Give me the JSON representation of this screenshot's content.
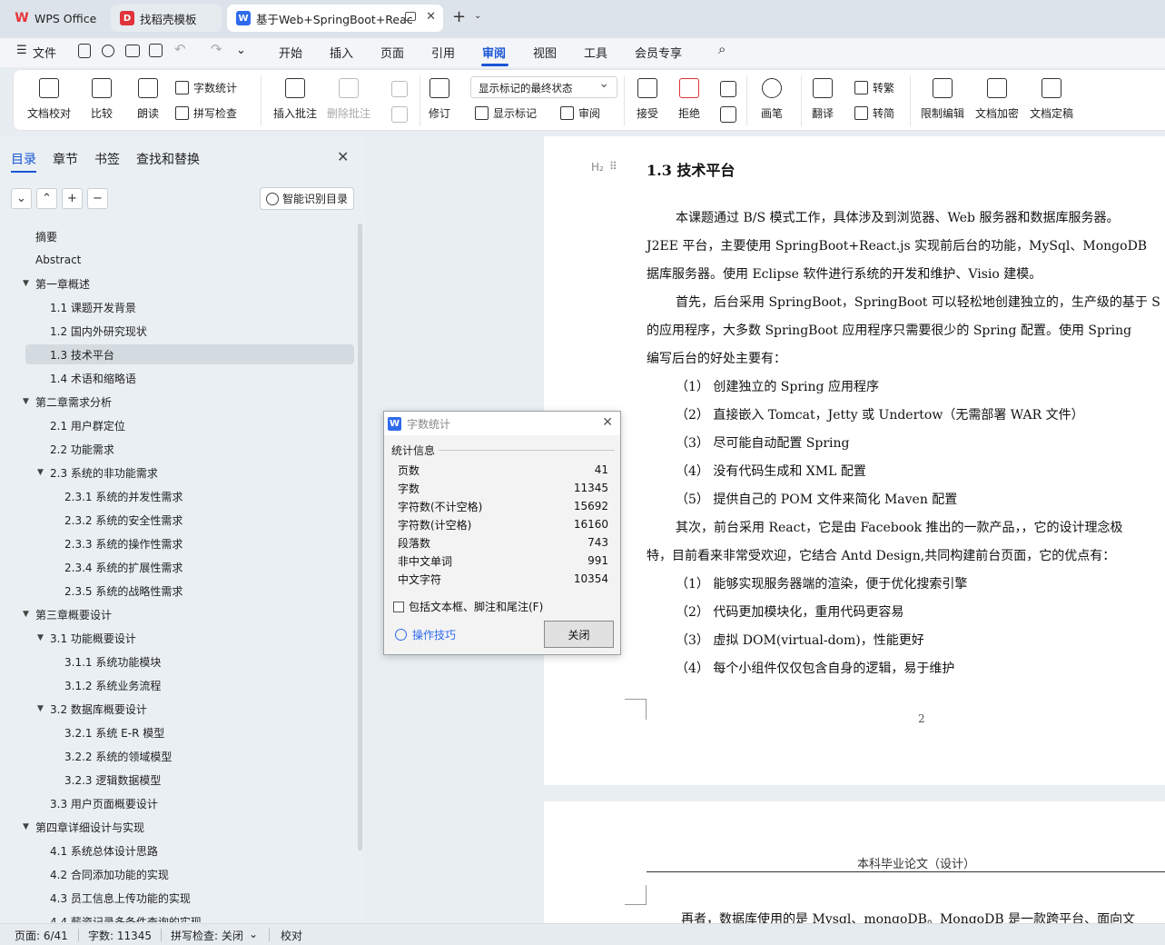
{
  "tabs": [
    {
      "label": "WPS Office"
    },
    {
      "label": "找稻壳模板"
    },
    {
      "label": "基于Web+SpringBoot+Reac"
    }
  ],
  "menu": {
    "file": "文件",
    "items": [
      "开始",
      "插入",
      "页面",
      "引用",
      "审阅",
      "视图",
      "工具",
      "会员专享"
    ]
  },
  "ribbon": {
    "proofread": "文档校对",
    "compare": "比较",
    "read_aloud": "朗读",
    "word_count": "字数统计",
    "spell_check": "拼写检查",
    "insert_comment": "插入批注",
    "delete_comment": "删除批注",
    "track_changes": "修订",
    "markup_state": "显示标记的最终状态",
    "show_markup": "显示标记",
    "review": "审阅",
    "accept": "接受",
    "reject": "拒绝",
    "ink": "画笔",
    "translate": "翻译",
    "to_traditional": "转繁",
    "to_simplified": "转简",
    "restrict_editing": "限制编辑",
    "encrypt": "文档加密",
    "finalize": "文档定稿"
  },
  "panel": {
    "tabs": [
      "目录",
      "章节",
      "书签",
      "查找和替换"
    ],
    "smart_toc": "智能识别目录",
    "toc": [
      {
        "label": "摘要",
        "level": 0
      },
      {
        "label": "Abstract",
        "level": 0
      },
      {
        "label": "第一章概述",
        "level": 0,
        "exp": true
      },
      {
        "label": "1.1  课题开发背景",
        "level": 1
      },
      {
        "label": "1.2  国内外研究现状",
        "level": 1
      },
      {
        "label": "1.3  技术平台",
        "level": 1,
        "selected": true
      },
      {
        "label": "1.4  术语和缩略语",
        "level": 1
      },
      {
        "label": "第二章需求分析",
        "level": 0,
        "exp": true
      },
      {
        "label": "2.1  用户群定位",
        "level": 1
      },
      {
        "label": "2.2  功能需求",
        "level": 1
      },
      {
        "label": "2.3  系统的非功能需求",
        "level": 1,
        "exp": true
      },
      {
        "label": "2.3.1  系统的并发性需求",
        "level": 2
      },
      {
        "label": "2.3.2  系统的安全性需求",
        "level": 2
      },
      {
        "label": "2.3.3  系统的操作性需求",
        "level": 2
      },
      {
        "label": "2.3.4  系统的扩展性需求",
        "level": 2
      },
      {
        "label": "2.3.5  系统的战略性需求",
        "level": 2
      },
      {
        "label": "第三章概要设计",
        "level": 0,
        "exp": true
      },
      {
        "label": "3.1 功能概要设计",
        "level": 1,
        "exp": true
      },
      {
        "label": "3.1.1  系统功能模块",
        "level": 2
      },
      {
        "label": "3.1.2  系统业务流程",
        "level": 2
      },
      {
        "label": "3.2  数据库概要设计",
        "level": 1,
        "exp": true
      },
      {
        "label": "3.2.1  系统 E-R 模型",
        "level": 2
      },
      {
        "label": "3.2.2  系统的领域模型",
        "level": 2
      },
      {
        "label": "3.2.3  逻辑数据模型",
        "level": 2
      },
      {
        "label": "3.3  用户页面概要设计",
        "level": 1
      },
      {
        "label": "第四章详细设计与实现",
        "level": 0,
        "exp": true
      },
      {
        "label": "4.1  系统总体设计思路",
        "level": 1
      },
      {
        "label": "4.2  合同添加功能的实现",
        "level": 1
      },
      {
        "label": "4.3  员工信息上传功能的实现",
        "level": 1
      },
      {
        "label": "4.4  薪资记录多条件查询的实现",
        "level": 1
      }
    ]
  },
  "document": {
    "heading": "1.3  技术平台",
    "lines": [
      {
        "text": "本课题通过 B/S 模式工作，具体涉及到浏览器、Web 服务器和数据库服务器。",
        "indent": true
      },
      {
        "text": "J2EE 平台，主要使用 SpringBoot+React.js 实现前后台的功能，MySql、MongoDB",
        "indent": false
      },
      {
        "text": "据库服务器。使用 Eclipse 软件进行系统的开发和维护、Visio 建模。",
        "indent": false
      },
      {
        "text": "首先，后台采用 SpringBoot，SpringBoot 可以轻松地创建独立的，生产级的基于 S",
        "indent": true
      },
      {
        "text": "的应用程序，大多数 SpringBoot 应用程序只需要很少的 Spring 配置。使用 Spring",
        "indent": false
      },
      {
        "text": "编写后台的好处主要有：",
        "indent": false
      },
      {
        "text": "（1）  创建独立的 Spring 应用程序",
        "indent": true
      },
      {
        "text": "（2）  直接嵌入 Tomcat，Jetty 或 Undertow（无需部署 WAR 文件）",
        "indent": true
      },
      {
        "text": "（3）  尽可能自动配置 Spring",
        "indent": true
      },
      {
        "text": "（4）  没有代码生成和 XML 配置",
        "indent": true
      },
      {
        "text": "（5）  提供自己的 POM 文件来简化 Maven 配置",
        "indent": true
      },
      {
        "text": "其次，前台采用 React，它是由 Facebook 推出的一款产品，，它的设计理念极",
        "indent": true
      },
      {
        "text": "特，目前看来非常受欢迎，它结合 Antd Design,共同构建前台页面，它的优点有：",
        "indent": false
      },
      {
        "text": "（1）  能够实现服务器端的渲染，便于优化搜索引擎",
        "indent": true
      },
      {
        "text": "（2）  代码更加模块化，重用代码更容易",
        "indent": true
      },
      {
        "text": "（3）  虚拟 DOM(virtual-dom)，性能更好",
        "indent": true
      },
      {
        "text": "（4）  每个小组件仅仅包含自身的逻辑，易于维护",
        "indent": true
      }
    ],
    "page_number": "2",
    "page2_header": "本科毕业论文（设计）",
    "page2_text": "再者，数据库使用的是 Mysql、mongoDB。MongoDB 是一款跨平台、面向文"
  },
  "dialog": {
    "title": "字数统计",
    "group": "统计信息",
    "stats": [
      {
        "label": "页数",
        "value": "41"
      },
      {
        "label": "字数",
        "value": "11345"
      },
      {
        "label": "字符数(不计空格)",
        "value": "15692"
      },
      {
        "label": "字符数(计空格)",
        "value": "16160"
      },
      {
        "label": "段落数",
        "value": "743"
      },
      {
        "label": "非中文单词",
        "value": "991"
      },
      {
        "label": "中文字符",
        "value": "10354"
      }
    ],
    "checkbox": "包括文本框、脚注和尾注(F)",
    "tips": "操作技巧",
    "close": "关闭"
  },
  "status": {
    "page": "页面: 6/41",
    "words": "字数: 11345",
    "spell": "拼写检查: 关闭",
    "proof": "校对"
  },
  "colors": {
    "accent": "#1a56d6",
    "doc_icon": "#2f6bec",
    "wps_red": "#e8343a"
  }
}
